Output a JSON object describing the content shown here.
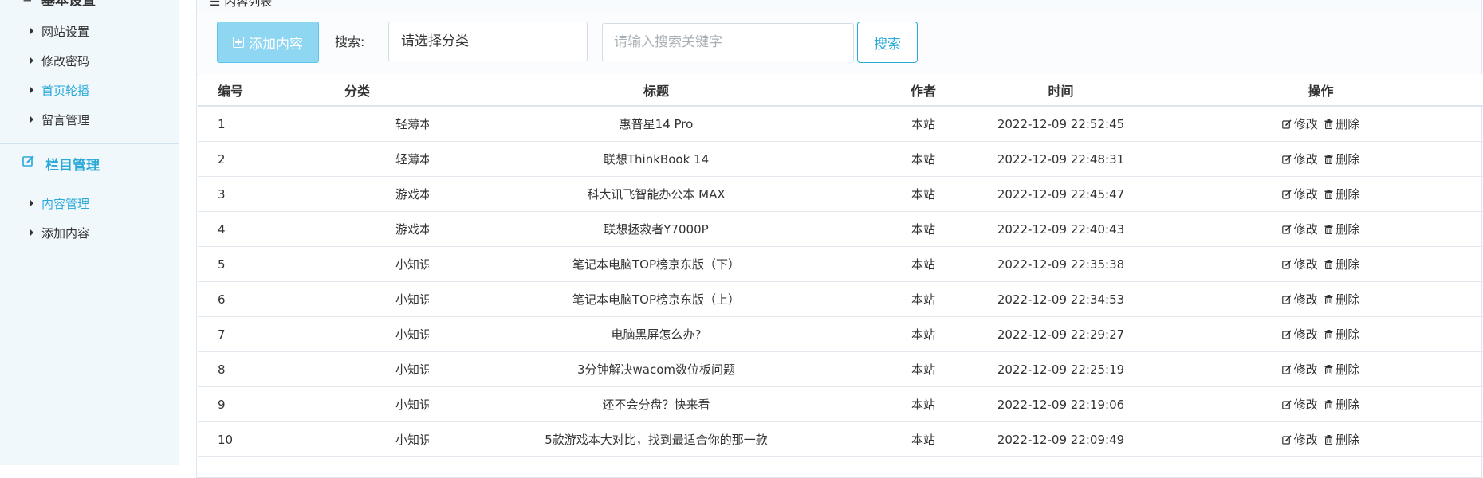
{
  "sidebar": {
    "top_header": {
      "title": "基本设置"
    },
    "group1": [
      {
        "label": "网站设置",
        "active": false
      },
      {
        "label": "修改密码",
        "active": false
      },
      {
        "label": "首页轮播",
        "active": true
      },
      {
        "label": "留言管理",
        "active": false
      }
    ],
    "section2": {
      "title": "栏目管理"
    },
    "group2": [
      {
        "label": "内容管理",
        "active": true
      },
      {
        "label": "添加内容",
        "active": false
      }
    ]
  },
  "panel": {
    "title": "内容列表"
  },
  "toolbar": {
    "add_label": "添加内容",
    "search_label": "搜索:",
    "category_select": "请选择分类",
    "search_placeholder": "请输入搜索关键字",
    "search_button": "搜索"
  },
  "table": {
    "headers": [
      "编号",
      "分类",
      "标题",
      "作者",
      "时间",
      "操作"
    ],
    "edit_label": "修改",
    "delete_label": "删除",
    "rows": [
      {
        "id": "1",
        "category": "轻薄本",
        "title": "惠普星14 Pro",
        "author": "本站",
        "time": "2022-12-09 22:52:45"
      },
      {
        "id": "2",
        "category": "轻薄本",
        "title": "联想ThinkBook 14",
        "author": "本站",
        "time": "2022-12-09 22:48:31"
      },
      {
        "id": "3",
        "category": "游戏本",
        "title": "科大讯飞智能办公本 MAX",
        "author": "本站",
        "time": "2022-12-09 22:45:47"
      },
      {
        "id": "4",
        "category": "游戏本",
        "title": "联想拯救者Y7000P",
        "author": "本站",
        "time": "2022-12-09 22:40:43"
      },
      {
        "id": "5",
        "category": "小知识",
        "title": "笔记本电脑TOP榜京东版（下）",
        "author": "本站",
        "time": "2022-12-09 22:35:38"
      },
      {
        "id": "6",
        "category": "小知识",
        "title": "笔记本电脑TOP榜京东版（上）",
        "author": "本站",
        "time": "2022-12-09 22:34:53"
      },
      {
        "id": "7",
        "category": "小知识",
        "title": "电脑黑屏怎么办?",
        "author": "本站",
        "time": "2022-12-09 22:29:27"
      },
      {
        "id": "8",
        "category": "小知识",
        "title": "3分钟解决wacom数位板问题",
        "author": "本站",
        "time": "2022-12-09 22:25:19"
      },
      {
        "id": "9",
        "category": "小知识",
        "title": "还不会分盘？快来看",
        "author": "本站",
        "time": "2022-12-09 22:19:06"
      },
      {
        "id": "10",
        "category": "小知识",
        "title": "5款游戏本大对比，找到最适合你的那一款",
        "author": "本站",
        "time": "2022-12-09 22:09:49"
      }
    ]
  },
  "colors": {
    "accent": "#2aa9d8",
    "sidebar_bg": "#f1f8fc",
    "add_button_bg": "#8ed6f2"
  }
}
